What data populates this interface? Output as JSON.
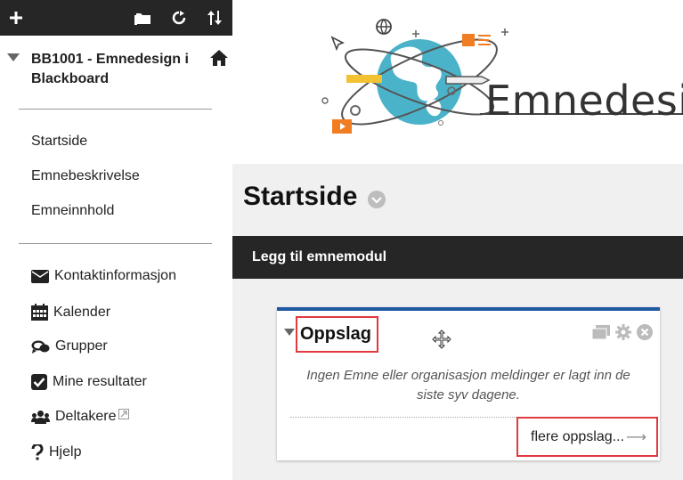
{
  "toolbar": {
    "add_icon": "plus-icon",
    "folder_icon": "folder-icon",
    "refresh_icon": "refresh-icon",
    "sort_icon": "sort-icon"
  },
  "course": {
    "title": "BB1001 - Emnedesign i Blackboard"
  },
  "nav": {
    "links": [
      "Startside",
      "Emnebeskrivelse",
      "Emneinnhold"
    ]
  },
  "tools": {
    "contact": "Kontaktinformasjon",
    "calendar": "Kalender",
    "groups": "Grupper",
    "grades": "Mine resultater",
    "participants": "Deltakere",
    "help": "Hjelp"
  },
  "banner": {
    "text": "Emnedesign"
  },
  "page": {
    "title": "Startside",
    "add_module": "Legg til emnemodul"
  },
  "module": {
    "title": "Oppslag",
    "message": "Ingen Emne eller organisasjon meldinger er lagt inn de siste syv dagene.",
    "more_link": "flere oppslag...",
    "more_arrow": "⟶"
  },
  "colors": {
    "dark_bar": "#262626",
    "highlight": "#e0393e",
    "module_accent": "#1f57a0",
    "globe": "#4bb3c9",
    "orange": "#f07d22"
  }
}
